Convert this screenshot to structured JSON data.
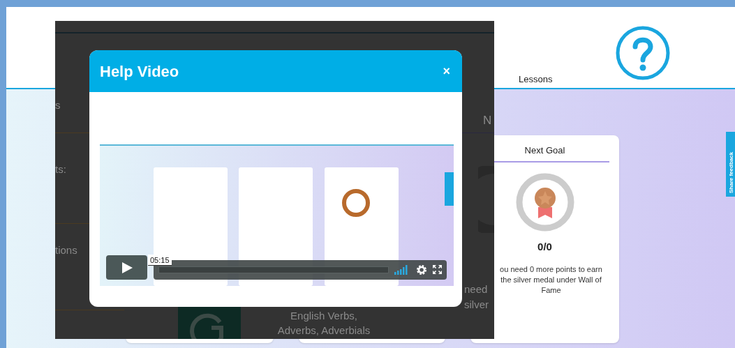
{
  "header": {
    "nav_label": "Lessons"
  },
  "next_goal": {
    "title": "Next Goal",
    "score": "0/0",
    "message_lines": [
      "ou need 0 more points to earn",
      "the silver medal under Wall of",
      "Fame"
    ]
  },
  "feedback_tab": {
    "label": "Share feedback"
  },
  "dimmed_page": {
    "left_texts": [
      "s",
      "ts:",
      "tions"
    ],
    "goal_initial": "N",
    "goal_message_lines": [
      "need",
      "silver"
    ],
    "lesson_lines": [
      "English Verbs,",
      "Adverbs, Adverbials"
    ]
  },
  "modal": {
    "title": "Help Video",
    "close": "×",
    "video": {
      "kind": "picture",
      "time": "05:15",
      "level": 0
    }
  }
}
